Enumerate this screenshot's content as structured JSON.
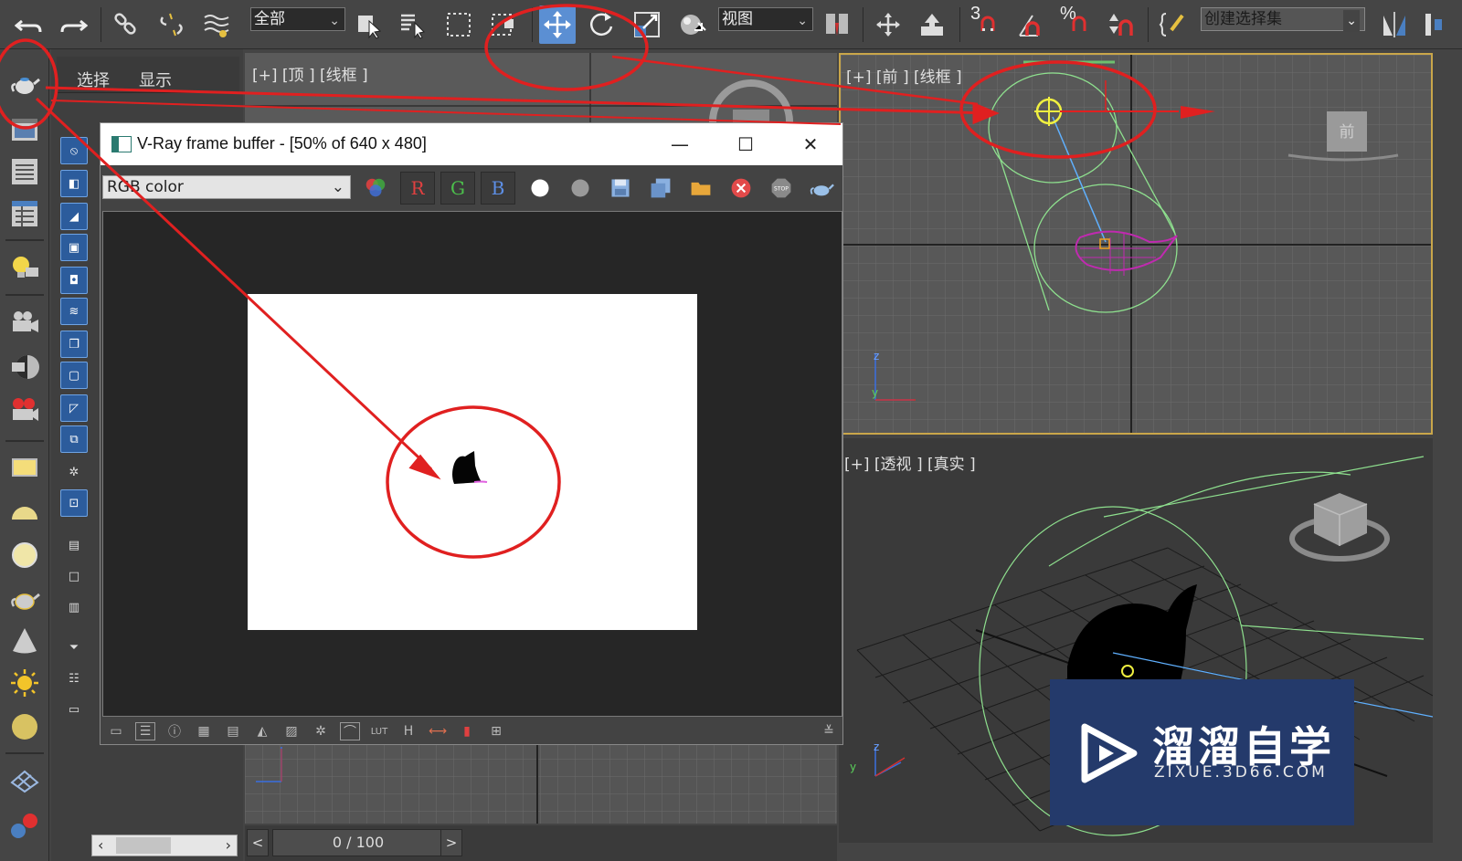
{
  "toolbar": {
    "selection_filter": "全部",
    "reference_coord": "视图",
    "named_selection_placeholder": "创建选择集",
    "snap_label": "3",
    "percent_label": "%"
  },
  "command_panel": {
    "tabs": [
      "选择",
      "显示"
    ]
  },
  "viewports": {
    "top_label": "[+] [顶 ] [线框 ]",
    "front_label": "[+] [前 ] [线框 ]",
    "persp_label": "[+] [透视 ] [真实 ]",
    "front_cube_label": "前"
  },
  "vfb": {
    "title": "V-Ray frame buffer - [50% of 640 x 480]",
    "channel": "RGB color",
    "channel_buttons": [
      "R",
      "G",
      "B"
    ],
    "window_controls": {
      "minimize": "—",
      "maximize": "☐",
      "close": "✕"
    }
  },
  "timeline": {
    "frame": "0 / 100",
    "prev": "<",
    "next": ">"
  },
  "watermark": {
    "title": "溜溜自学",
    "sub": "ZIXUE.3D66.COM"
  },
  "colors": {
    "annotation": "#e02020",
    "active_tool": "#5b8fd3",
    "viewport_border": "#c9a64a"
  }
}
